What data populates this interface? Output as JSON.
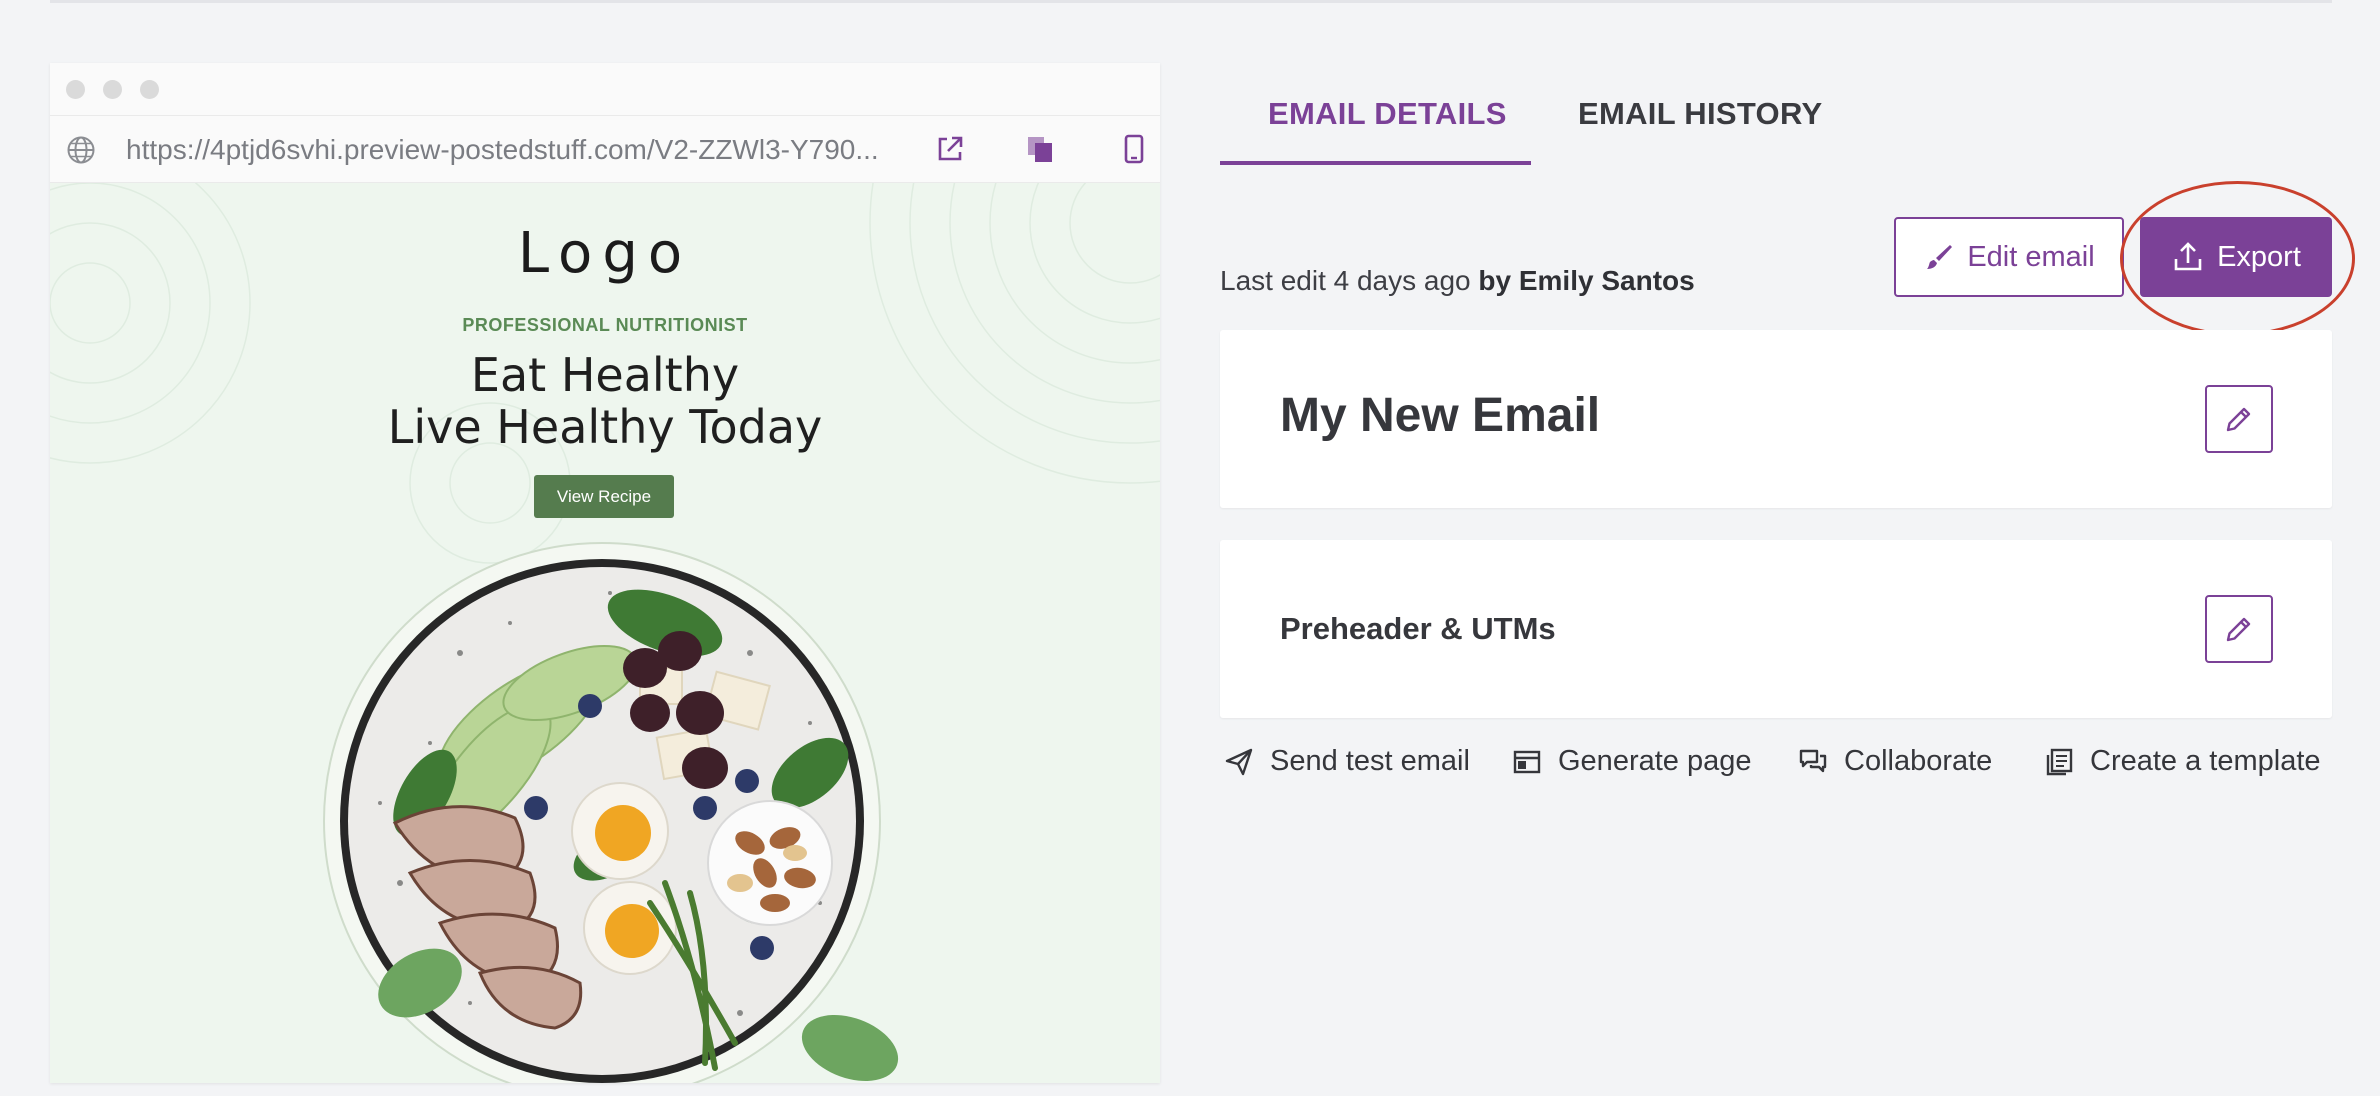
{
  "preview": {
    "url": "https://4ptjd6svhi.preview-postedstuff.com/V2-ZZWl3-Y790...",
    "email": {
      "logo": "Logo",
      "kicker": "PROFESSIONAL NUTRITIONIST",
      "headline_line1": "Eat Healthy",
      "headline_line2": "Live Healthy Today",
      "button": "View Recipe"
    }
  },
  "tabs": [
    {
      "label": "EMAIL DETAILS",
      "active": true
    },
    {
      "label": "EMAIL HISTORY",
      "active": false
    }
  ],
  "meta": {
    "last_edit_prefix": "Last edit 4 days ago",
    "last_edit_by": "by Emily Santos"
  },
  "buttons": {
    "edit_email": "Edit email",
    "export": "Export"
  },
  "cards": [
    {
      "title": "My New Email"
    },
    {
      "title": "Preheader & UTMs"
    }
  ],
  "actions": [
    {
      "label": "Send test email",
      "icon": "send-icon"
    },
    {
      "label": "Generate page",
      "icon": "page-icon"
    },
    {
      "label": "Collaborate",
      "icon": "chat-icon"
    },
    {
      "label": "Create a template",
      "icon": "template-icon"
    }
  ],
  "colors": {
    "accent": "#7b4197",
    "highlight": "#c9402d",
    "email_green": "#557c4e",
    "email_bg": "#eef6ee"
  }
}
